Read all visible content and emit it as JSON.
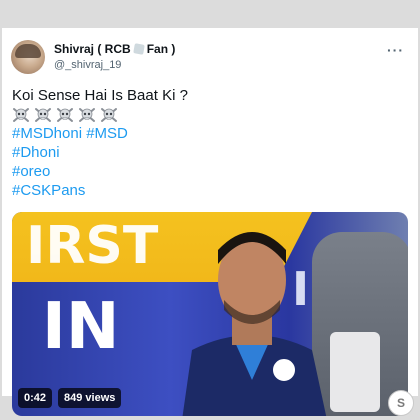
{
  "tweet": {
    "display_name": "Shivraj ( RCB",
    "display_name_suffix": "Fan )",
    "handle": "@_shivraj_19",
    "more_label": "···",
    "text": "Koi Sense Hai Is Baat Ki ?",
    "emoji_count": 5,
    "emoji_icon": "skull-crossbones-icon",
    "hashtags": [
      "#MSDhoni",
      "#MSD",
      "#Dhoni",
      "#oreo",
      "#CSKPans"
    ],
    "media": {
      "duration": "0:42",
      "views": "849 views"
    }
  },
  "colors": {
    "link": "#1d9bf0",
    "text": "#0f1419",
    "muted": "#536471"
  }
}
